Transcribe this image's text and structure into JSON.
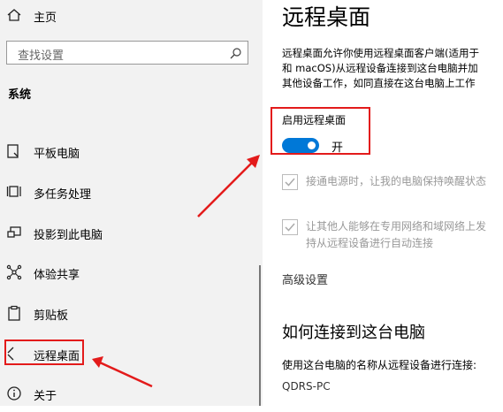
{
  "sidebar": {
    "home_label": "主页",
    "search_placeholder": "查找设置",
    "section_label": "系统",
    "items": [
      {
        "label": "平板电脑"
      },
      {
        "label": "多任务处理"
      },
      {
        "label": "投影到此电脑"
      },
      {
        "label": "体验共享"
      },
      {
        "label": "剪贴板"
      },
      {
        "label": "远程桌面"
      },
      {
        "label": "关于"
      }
    ],
    "selected_item": "远程桌面"
  },
  "main": {
    "title": "远程桌面",
    "description_lines": [
      "远程桌面允许你使用远程桌面客户端(适用于",
      "和 macOS)从远程设备连接到这台电脑并加",
      "其他设备工作，如同直接在这台电脑上工作"
    ],
    "enable_label": "启用远程桌面",
    "toggle_state": "开",
    "toggle_on": true,
    "checkbox1_label": "接通电源时，让我的电脑保持唤醒状态",
    "checkbox2_lines": [
      "让其他人能够在专用网络和域网络上发",
      "持从远程设备进行自动连接"
    ],
    "advanced_settings": "高级设置",
    "how_to_title": "如何连接到这台电脑",
    "how_to_desc": "使用这台电脑的名称从远程设备进行连接:",
    "pc_name": "QDRS-PC"
  },
  "colors": {
    "accent": "#0078d7",
    "annotation_red": "#e31b1b",
    "sidebar_bg": "#f2f2f2"
  }
}
